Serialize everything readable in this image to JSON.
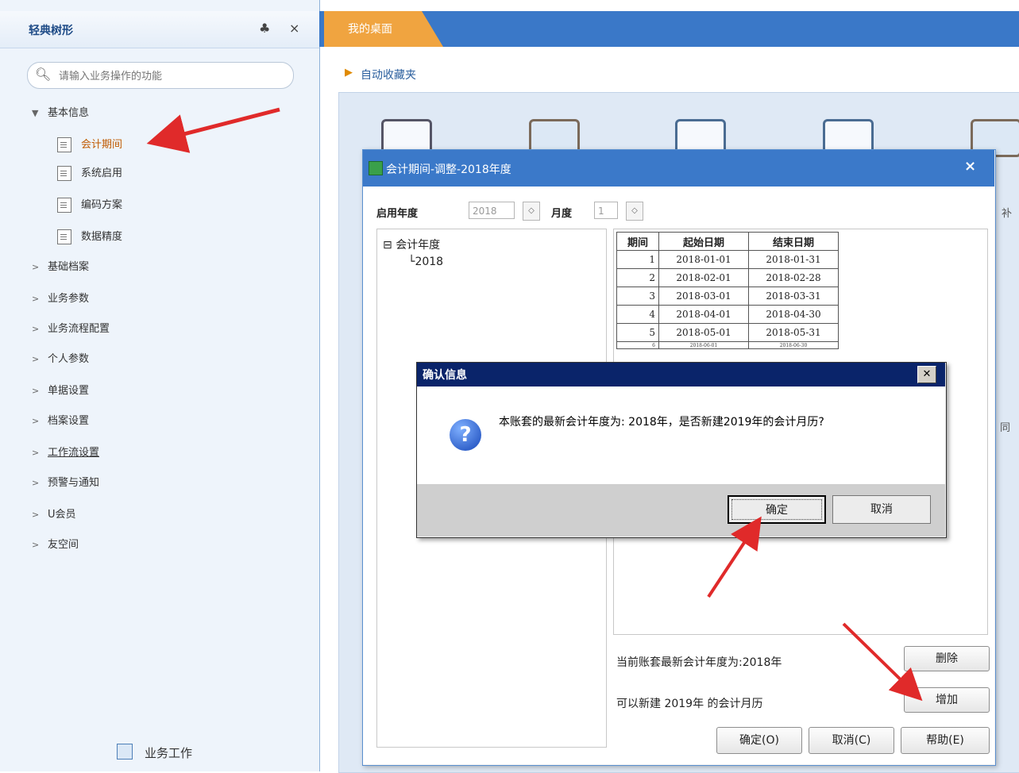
{
  "left_panel": {
    "title": "轻典树形",
    "pin_glyph": "♣",
    "close_glyph": "×",
    "search_placeholder": "请输入业务操作的功能",
    "groups": [
      {
        "label": "基本信息",
        "expanded": true,
        "children": [
          "会计期间",
          "系统启用",
          "编码方案",
          "数据精度"
        ]
      },
      {
        "label": "基础档案"
      },
      {
        "label": "业务参数"
      },
      {
        "label": "业务流程配置"
      },
      {
        "label": "个人参数"
      },
      {
        "label": "单据设置"
      },
      {
        "label": "档案设置"
      },
      {
        "label": "工作流设置"
      },
      {
        "label": "预警与通知"
      },
      {
        "label": "U会员"
      },
      {
        "label": "友空间"
      }
    ],
    "footer_label": "业务工作"
  },
  "top_tab": {
    "label": "我的桌面"
  },
  "favorites_label": "自动收藏夹",
  "background_side_text": [
    "补",
    "同"
  ],
  "period_dialog": {
    "title": "会计期间-调整-2018年度",
    "close_glyph": "×",
    "year_label": "启用年度",
    "year_value": "2018",
    "month_label": "月度",
    "month_value": "1",
    "tree_root": "会计年度",
    "tree_child": "2018",
    "table": {
      "headers": [
        "期间",
        "起始日期",
        "结束日期"
      ],
      "rows": [
        [
          "1",
          "2018-01-01",
          "2018-01-31"
        ],
        [
          "2",
          "2018-02-01",
          "2018-02-28"
        ],
        [
          "3",
          "2018-03-01",
          "2018-03-31"
        ],
        [
          "4",
          "2018-04-01",
          "2018-04-30"
        ],
        [
          "5",
          "2018-05-01",
          "2018-05-31"
        ],
        [
          "6",
          "2018-06-01",
          "2018-06-30"
        ]
      ]
    },
    "info_line1": "当前账套最新会计年度为:2018年",
    "info_line2": "可以新建 2019年 的会计月历",
    "delete_label": "删除",
    "add_label": "增加",
    "ok_label": "确定(O)",
    "cancel_label": "取消(C)",
    "help_label": "帮助(E)"
  },
  "confirm_dialog": {
    "title": "确认信息",
    "close_glyph": "✕",
    "icon_glyph": "?",
    "message": "本账套的最新会计年度为: 2018年，是否新建2019年的会计月历?",
    "ok_label": "确定",
    "cancel_label": "取消"
  },
  "colors": {
    "title_bar": "#3b79c9",
    "tab": "#f0a440",
    "annotation_arrow": "#e02a2a",
    "msg_title_bar": "#0a246a"
  }
}
